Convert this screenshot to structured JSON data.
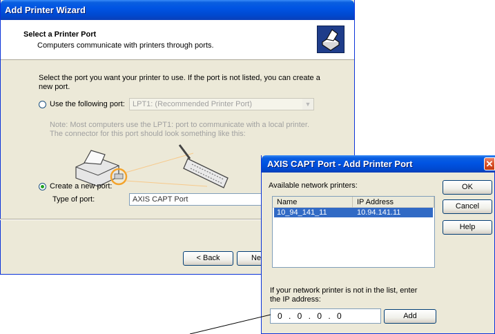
{
  "wizard": {
    "title": "Add Printer Wizard",
    "header_title": "Select a Printer Port",
    "header_subtitle": "Computers communicate with printers through ports.",
    "intro": "Select the port you want your printer to use.  If the port is not listed, you can create a new port.",
    "use_port_label": "Use the following port:",
    "port_select_value": "LPT1: (Recommended Printer Port)",
    "note": "Note: Most computers use the LPT1: port to communicate with a local printer. The connector for this port should look something like this:",
    "create_port_label": "Create a new port:",
    "type_label": "Type of port:",
    "type_value": "AXIS CAPT Port",
    "back_label": "< Back",
    "next_label": "Ne",
    "selected_option": "create",
    "icons": [
      "printer-wizard-icon",
      "parallel-connector-art"
    ]
  },
  "axis_dialog": {
    "title": "AXIS CAPT Port - Add Printer Port",
    "close_glyph": "✕",
    "available_label": "Available network printers:",
    "columns": [
      "Name",
      "IP Address"
    ],
    "rows": [
      {
        "name": "10_94_141_11",
        "ip": "10.94.141.11"
      }
    ],
    "ok_label": "OK",
    "cancel_label": "Cancel",
    "help_label": "Help",
    "hint": "If your network printer is not in the list, enter the IP address:",
    "ip_value": "0 . 0 . 0 . 0",
    "add_label": "Add"
  },
  "colors": {
    "title_bar": "#0054e3",
    "dialog_bg": "#ece9d8",
    "selection": "#316ac5"
  }
}
